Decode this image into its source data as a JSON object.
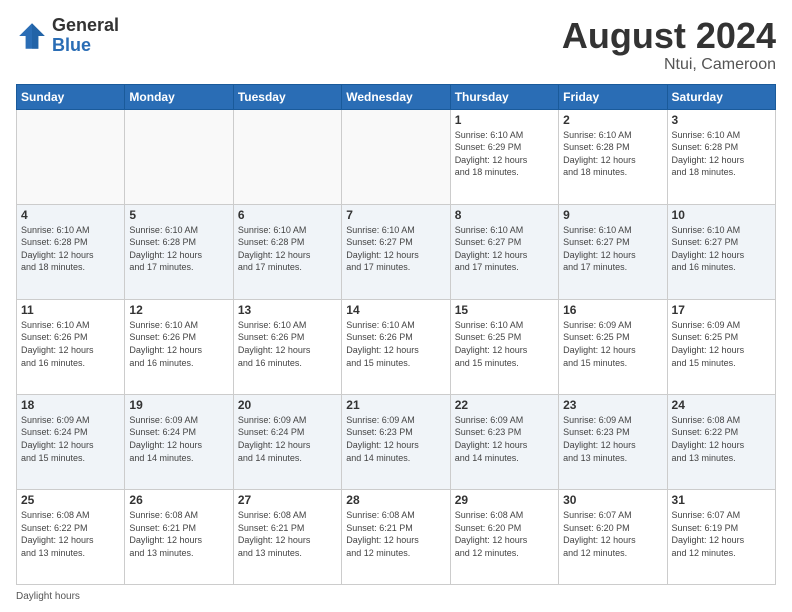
{
  "header": {
    "logo_general": "General",
    "logo_blue": "Blue",
    "title": "August 2024",
    "location": "Ntui, Cameroon"
  },
  "footer": {
    "note": "Daylight hours"
  },
  "days_of_week": [
    "Sunday",
    "Monday",
    "Tuesday",
    "Wednesday",
    "Thursday",
    "Friday",
    "Saturday"
  ],
  "weeks": [
    [
      {
        "day": "",
        "info": ""
      },
      {
        "day": "",
        "info": ""
      },
      {
        "day": "",
        "info": ""
      },
      {
        "day": "",
        "info": ""
      },
      {
        "day": "1",
        "info": "Sunrise: 6:10 AM\nSunset: 6:29 PM\nDaylight: 12 hours\nand 18 minutes."
      },
      {
        "day": "2",
        "info": "Sunrise: 6:10 AM\nSunset: 6:28 PM\nDaylight: 12 hours\nand 18 minutes."
      },
      {
        "day": "3",
        "info": "Sunrise: 6:10 AM\nSunset: 6:28 PM\nDaylight: 12 hours\nand 18 minutes."
      }
    ],
    [
      {
        "day": "4",
        "info": "Sunrise: 6:10 AM\nSunset: 6:28 PM\nDaylight: 12 hours\nand 18 minutes."
      },
      {
        "day": "5",
        "info": "Sunrise: 6:10 AM\nSunset: 6:28 PM\nDaylight: 12 hours\nand 17 minutes."
      },
      {
        "day": "6",
        "info": "Sunrise: 6:10 AM\nSunset: 6:28 PM\nDaylight: 12 hours\nand 17 minutes."
      },
      {
        "day": "7",
        "info": "Sunrise: 6:10 AM\nSunset: 6:27 PM\nDaylight: 12 hours\nand 17 minutes."
      },
      {
        "day": "8",
        "info": "Sunrise: 6:10 AM\nSunset: 6:27 PM\nDaylight: 12 hours\nand 17 minutes."
      },
      {
        "day": "9",
        "info": "Sunrise: 6:10 AM\nSunset: 6:27 PM\nDaylight: 12 hours\nand 17 minutes."
      },
      {
        "day": "10",
        "info": "Sunrise: 6:10 AM\nSunset: 6:27 PM\nDaylight: 12 hours\nand 16 minutes."
      }
    ],
    [
      {
        "day": "11",
        "info": "Sunrise: 6:10 AM\nSunset: 6:26 PM\nDaylight: 12 hours\nand 16 minutes."
      },
      {
        "day": "12",
        "info": "Sunrise: 6:10 AM\nSunset: 6:26 PM\nDaylight: 12 hours\nand 16 minutes."
      },
      {
        "day": "13",
        "info": "Sunrise: 6:10 AM\nSunset: 6:26 PM\nDaylight: 12 hours\nand 16 minutes."
      },
      {
        "day": "14",
        "info": "Sunrise: 6:10 AM\nSunset: 6:26 PM\nDaylight: 12 hours\nand 15 minutes."
      },
      {
        "day": "15",
        "info": "Sunrise: 6:10 AM\nSunset: 6:25 PM\nDaylight: 12 hours\nand 15 minutes."
      },
      {
        "day": "16",
        "info": "Sunrise: 6:09 AM\nSunset: 6:25 PM\nDaylight: 12 hours\nand 15 minutes."
      },
      {
        "day": "17",
        "info": "Sunrise: 6:09 AM\nSunset: 6:25 PM\nDaylight: 12 hours\nand 15 minutes."
      }
    ],
    [
      {
        "day": "18",
        "info": "Sunrise: 6:09 AM\nSunset: 6:24 PM\nDaylight: 12 hours\nand 15 minutes."
      },
      {
        "day": "19",
        "info": "Sunrise: 6:09 AM\nSunset: 6:24 PM\nDaylight: 12 hours\nand 14 minutes."
      },
      {
        "day": "20",
        "info": "Sunrise: 6:09 AM\nSunset: 6:24 PM\nDaylight: 12 hours\nand 14 minutes."
      },
      {
        "day": "21",
        "info": "Sunrise: 6:09 AM\nSunset: 6:23 PM\nDaylight: 12 hours\nand 14 minutes."
      },
      {
        "day": "22",
        "info": "Sunrise: 6:09 AM\nSunset: 6:23 PM\nDaylight: 12 hours\nand 14 minutes."
      },
      {
        "day": "23",
        "info": "Sunrise: 6:09 AM\nSunset: 6:23 PM\nDaylight: 12 hours\nand 13 minutes."
      },
      {
        "day": "24",
        "info": "Sunrise: 6:08 AM\nSunset: 6:22 PM\nDaylight: 12 hours\nand 13 minutes."
      }
    ],
    [
      {
        "day": "25",
        "info": "Sunrise: 6:08 AM\nSunset: 6:22 PM\nDaylight: 12 hours\nand 13 minutes."
      },
      {
        "day": "26",
        "info": "Sunrise: 6:08 AM\nSunset: 6:21 PM\nDaylight: 12 hours\nand 13 minutes."
      },
      {
        "day": "27",
        "info": "Sunrise: 6:08 AM\nSunset: 6:21 PM\nDaylight: 12 hours\nand 13 minutes."
      },
      {
        "day": "28",
        "info": "Sunrise: 6:08 AM\nSunset: 6:21 PM\nDaylight: 12 hours\nand 12 minutes."
      },
      {
        "day": "29",
        "info": "Sunrise: 6:08 AM\nSunset: 6:20 PM\nDaylight: 12 hours\nand 12 minutes."
      },
      {
        "day": "30",
        "info": "Sunrise: 6:07 AM\nSunset: 6:20 PM\nDaylight: 12 hours\nand 12 minutes."
      },
      {
        "day": "31",
        "info": "Sunrise: 6:07 AM\nSunset: 6:19 PM\nDaylight: 12 hours\nand 12 minutes."
      }
    ]
  ]
}
